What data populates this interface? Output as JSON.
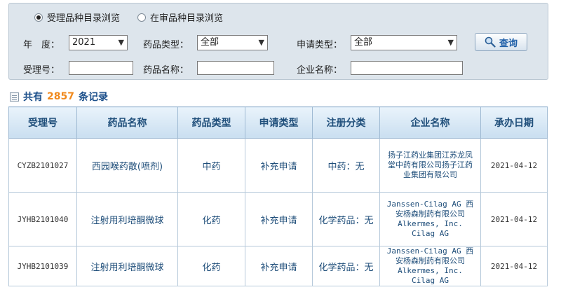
{
  "search_mode": {
    "options": [
      {
        "label": "受理品种目录浏览",
        "selected": true
      },
      {
        "label": "在审品种目录浏览",
        "selected": false
      }
    ]
  },
  "filters": {
    "year_label": "年　度：",
    "year_value": "2021",
    "drug_type_label": "药品类型：",
    "drug_type_value": "全部",
    "apply_type_label": "申请类型：",
    "apply_type_value": "全部",
    "accept_no_label": "受理号：",
    "drug_name_label": "药品名称：",
    "company_label": "企业名称："
  },
  "query_button": {
    "label": "查询"
  },
  "records": {
    "prefix": "共有",
    "count": "2857",
    "suffix": "条记录"
  },
  "table": {
    "headers": [
      "受理号",
      "药品名称",
      "药品类型",
      "申请类型",
      "注册分类",
      "企业名称",
      "承办日期"
    ],
    "rows": [
      {
        "accept_no": "CYZB2101027",
        "drug_name": "西园喉药散(喷剂)",
        "drug_type": "中药",
        "apply_type": "补充申请",
        "reg_class": "中药：无",
        "company": "扬子江药业集团江苏龙凤堂中药有限公司扬子江药业集团有限公司",
        "date": "2021-04-12"
      },
      {
        "accept_no": "JYHB2101040",
        "drug_name": "注射用利培酮微球",
        "drug_type": "化药",
        "apply_type": "补充申请",
        "reg_class": "化学药品：无",
        "company": "Janssen-Cilag AG 西安杨森制药有限公司 Alkermes, Inc. Cilag AG",
        "date": "2021-04-12"
      },
      {
        "accept_no": "JYHB2101039",
        "drug_name": "注射用利培酮微球",
        "drug_type": "化药",
        "apply_type": "补充申请",
        "reg_class": "化学药品：无",
        "company": "Janssen-Cilag AG 西安杨森制药有限公司 Alkermes, Inc. Cilag AG",
        "date": "2021-04-12"
      }
    ]
  },
  "colors": {
    "accent": "#1b4f8a",
    "count": "#f0891c",
    "panel": "#dde5ec"
  },
  "icons": [
    "radio-icon",
    "list-icon",
    "magnifier-icon",
    "chevron-down-icon"
  ]
}
